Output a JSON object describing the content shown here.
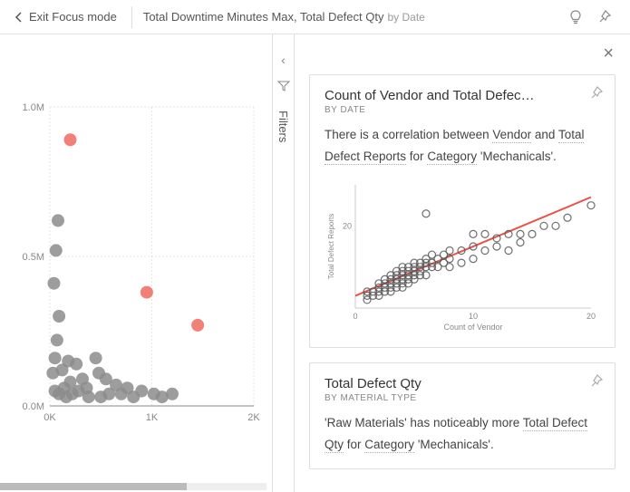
{
  "topbar": {
    "exit_label": "Exit Focus mode",
    "title_main": "Total Downtime Minutes Max, Total Defect Qty",
    "title_sub": "by Date"
  },
  "filters": {
    "label": "Filters"
  },
  "insight1": {
    "title": "Count of Vendor and Total Defec…",
    "subtitle": "BY DATE",
    "text_pre": "There is a correlation between ",
    "u1": "Vendor",
    "text_mid1": " and ",
    "u2": "Total Defect Reports",
    "text_mid2": " for ",
    "u3": "Category",
    "text_end": " 'Mechanicals'.",
    "mini_ylabel": "Total Defect Reports",
    "mini_xlabel": "Count of Vendor",
    "mini_ytick": "20",
    "mini_xticks": {
      "a": "0",
      "b": "10",
      "c": "20"
    }
  },
  "insight2": {
    "title": "Total Defect Qty",
    "subtitle": "BY MATERIAL TYPE",
    "text_pre": "'Raw Materials' has noticeably more ",
    "u1": "Total Defect Qty",
    "text_mid": " for ",
    "u2": "Category",
    "text_end": " 'Mechanicals'."
  },
  "chart_data": [
    {
      "type": "scatter",
      "title": "Total Downtime Minutes Max, Total Defect Qty by Date",
      "xlabel": "",
      "ylabel": "",
      "x_ticks": [
        "0K",
        "1K",
        "2K"
      ],
      "y_ticks": [
        "0.0M",
        "0.5M",
        "1.0M"
      ],
      "xlim": [
        0,
        2000
      ],
      "ylim": [
        0,
        1000000
      ],
      "series": [
        {
          "name": "normal",
          "color": "#8c8c8c",
          "points": [
            {
              "x": 50,
              "y": 50000
            },
            {
              "x": 80,
              "y": 620000
            },
            {
              "x": 60,
              "y": 520000
            },
            {
              "x": 40,
              "y": 410000
            },
            {
              "x": 90,
              "y": 300000
            },
            {
              "x": 70,
              "y": 220000
            },
            {
              "x": 50,
              "y": 160000
            },
            {
              "x": 30,
              "y": 110000
            },
            {
              "x": 120,
              "y": 120000
            },
            {
              "x": 180,
              "y": 150000
            },
            {
              "x": 260,
              "y": 140000
            },
            {
              "x": 200,
              "y": 80000
            },
            {
              "x": 280,
              "y": 50000
            },
            {
              "x": 360,
              "y": 60000
            },
            {
              "x": 480,
              "y": 110000
            },
            {
              "x": 380,
              "y": 30000
            },
            {
              "x": 500,
              "y": 30000
            },
            {
              "x": 580,
              "y": 40000
            },
            {
              "x": 700,
              "y": 40000
            },
            {
              "x": 820,
              "y": 30000
            },
            {
              "x": 900,
              "y": 50000
            },
            {
              "x": 1020,
              "y": 40000
            },
            {
              "x": 1100,
              "y": 30000
            },
            {
              "x": 1200,
              "y": 40000
            },
            {
              "x": 450,
              "y": 160000
            },
            {
              "x": 320,
              "y": 90000
            },
            {
              "x": 140,
              "y": 60000
            },
            {
              "x": 220,
              "y": 40000
            },
            {
              "x": 160,
              "y": 30000
            },
            {
              "x": 90,
              "y": 40000
            },
            {
              "x": 650,
              "y": 70000
            },
            {
              "x": 760,
              "y": 60000
            },
            {
              "x": 550,
              "y": 90000
            }
          ]
        },
        {
          "name": "highlighted",
          "color": "#f08078",
          "points": [
            {
              "x": 200,
              "y": 890000
            },
            {
              "x": 950,
              "y": 380000
            },
            {
              "x": 1450,
              "y": 270000
            }
          ]
        }
      ]
    },
    {
      "type": "scatter",
      "title": "Count of Vendor and Total Defect Reports",
      "xlabel": "Count of Vendor",
      "ylabel": "Total Defect Reports",
      "xlim": [
        0,
        20
      ],
      "ylim": [
        0,
        30
      ],
      "trend": {
        "x1": 0,
        "y1": 3,
        "x2": 20,
        "y2": 27
      },
      "series": [
        {
          "name": "points",
          "points": [
            {
              "x": 1,
              "y": 2
            },
            {
              "x": 1,
              "y": 3
            },
            {
              "x": 1,
              "y": 4
            },
            {
              "x": 1.5,
              "y": 3
            },
            {
              "x": 1.5,
              "y": 4
            },
            {
              "x": 2,
              "y": 3
            },
            {
              "x": 2,
              "y": 4
            },
            {
              "x": 2,
              "y": 5
            },
            {
              "x": 2,
              "y": 6
            },
            {
              "x": 2.5,
              "y": 4
            },
            {
              "x": 2.5,
              "y": 5
            },
            {
              "x": 2.5,
              "y": 6
            },
            {
              "x": 2.5,
              "y": 7
            },
            {
              "x": 3,
              "y": 4
            },
            {
              "x": 3,
              "y": 5
            },
            {
              "x": 3,
              "y": 6
            },
            {
              "x": 3,
              "y": 7
            },
            {
              "x": 3,
              "y": 8
            },
            {
              "x": 3.5,
              "y": 5
            },
            {
              "x": 3.5,
              "y": 6
            },
            {
              "x": 3.5,
              "y": 7
            },
            {
              "x": 3.5,
              "y": 8
            },
            {
              "x": 3.5,
              "y": 9
            },
            {
              "x": 4,
              "y": 5
            },
            {
              "x": 4,
              "y": 6
            },
            {
              "x": 4,
              "y": 7
            },
            {
              "x": 4,
              "y": 8
            },
            {
              "x": 4,
              "y": 9
            },
            {
              "x": 4,
              "y": 10
            },
            {
              "x": 4.5,
              "y": 6
            },
            {
              "x": 4.5,
              "y": 7
            },
            {
              "x": 4.5,
              "y": 8
            },
            {
              "x": 4.5,
              "y": 9
            },
            {
              "x": 4.5,
              "y": 10
            },
            {
              "x": 5,
              "y": 7
            },
            {
              "x": 5,
              "y": 8
            },
            {
              "x": 5,
              "y": 9
            },
            {
              "x": 5,
              "y": 10
            },
            {
              "x": 5,
              "y": 11
            },
            {
              "x": 5.5,
              "y": 8
            },
            {
              "x": 5.5,
              "y": 9
            },
            {
              "x": 5.5,
              "y": 10
            },
            {
              "x": 5.5,
              "y": 11
            },
            {
              "x": 6,
              "y": 8
            },
            {
              "x": 6,
              "y": 10
            },
            {
              "x": 6,
              "y": 11
            },
            {
              "x": 6,
              "y": 12
            },
            {
              "x": 6.5,
              "y": 10
            },
            {
              "x": 6.5,
              "y": 11
            },
            {
              "x": 6.5,
              "y": 13
            },
            {
              "x": 7,
              "y": 10
            },
            {
              "x": 7,
              "y": 12
            },
            {
              "x": 7.5,
              "y": 11
            },
            {
              "x": 7.5,
              "y": 13
            },
            {
              "x": 8,
              "y": 10
            },
            {
              "x": 8,
              "y": 12
            },
            {
              "x": 8,
              "y": 14
            },
            {
              "x": 6,
              "y": 23
            },
            {
              "x": 9,
              "y": 11
            },
            {
              "x": 9,
              "y": 14
            },
            {
              "x": 10,
              "y": 12
            },
            {
              "x": 10,
              "y": 15
            },
            {
              "x": 10,
              "y": 18
            },
            {
              "x": 11,
              "y": 14
            },
            {
              "x": 11,
              "y": 18
            },
            {
              "x": 12,
              "y": 15
            },
            {
              "x": 12,
              "y": 17
            },
            {
              "x": 13,
              "y": 18
            },
            {
              "x": 13,
              "y": 14
            },
            {
              "x": 14,
              "y": 16
            },
            {
              "x": 14,
              "y": 18
            },
            {
              "x": 15,
              "y": 18
            },
            {
              "x": 16,
              "y": 20
            },
            {
              "x": 17,
              "y": 20
            },
            {
              "x": 18,
              "y": 22
            },
            {
              "x": 20,
              "y": 25
            }
          ]
        }
      ]
    }
  ]
}
